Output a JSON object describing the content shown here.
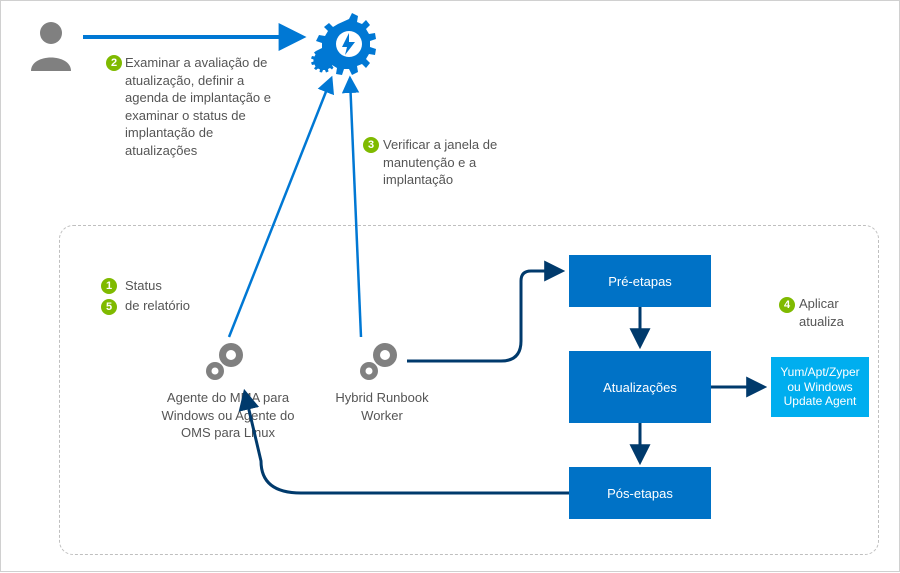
{
  "diagram": {
    "badges": {
      "n1": "1",
      "n2": "2",
      "n3": "3",
      "n4": "4",
      "n5": "5"
    },
    "labels": {
      "step2": "Examinar a avaliação de atualização, definir a agenda de implantação e examinar o status de implantação de atualizações",
      "step3": "Verificar a janela de manutenção e a implantação",
      "status_line1": "Status",
      "status_line2": "de relatório",
      "step4_line1": "Aplicar",
      "step4_line2": "atualiza",
      "mma_agent": "Agente do MMA para Windows ou Agente do OMS para Linux",
      "hrw": "Hybrid Runbook Worker"
    },
    "boxes": {
      "pre": "Pré-etapas",
      "updates": "Atualizações",
      "post": "Pós-etapas",
      "yum": "Yum/Apt/Zyper ou Windows Update Agent"
    },
    "colors": {
      "blue_primary": "#0078d4",
      "blue_box": "#0072c6",
      "cyan_box": "#00aeef",
      "green": "#7fba00",
      "gray": "#808080"
    }
  }
}
